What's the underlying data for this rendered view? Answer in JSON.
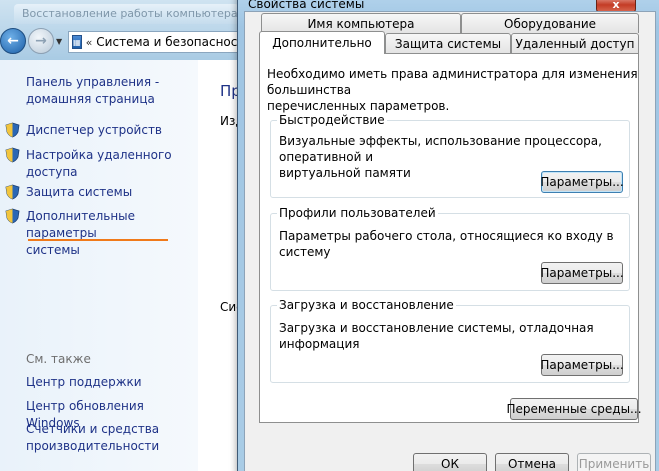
{
  "background": {
    "ghost_tab": "Восстановление работы компьютера",
    "address": {
      "chevron": "«",
      "path": "Система и безопасност"
    },
    "left_pane": {
      "home_link": [
        "Панель управления -",
        "домашняя страница"
      ],
      "links": [
        {
          "lines": [
            "Диспетчер устройств"
          ],
          "icon": "shield-icon"
        },
        {
          "lines": [
            "Настройка удаленного",
            "доступа"
          ],
          "icon": "shield-icon"
        },
        {
          "lines": [
            "Защита системы"
          ],
          "icon": "shield-icon"
        },
        {
          "lines": [
            "Дополнительные параметры",
            "системы"
          ],
          "icon": "shield-icon"
        }
      ],
      "see_also": "См. также",
      "see_also_links": [
        [
          "Центр поддержки"
        ],
        [
          "Центр обновления Windows"
        ],
        [
          "Счетчики и средства",
          "производительности"
        ]
      ]
    },
    "main_fragments": {
      "title": "Пр",
      "frag1": "Изд",
      "frag2": "Сис"
    }
  },
  "dialog": {
    "title": "Свойства системы",
    "close_label": "x",
    "tabs_back": [
      "Имя компьютера",
      "Оборудование"
    ],
    "tabs_front": [
      "Дополнительно",
      "Защита системы",
      "Удаленный доступ"
    ],
    "active_tab": "Дополнительно",
    "admin_note": [
      "Необходимо иметь права администратора для изменения большинства",
      "перечисленных параметров."
    ],
    "groups": [
      {
        "label": "Быстродействие",
        "text": [
          "Визуальные эффекты, использование процессора, оперативной и",
          "виртуальной памяти"
        ],
        "button": "Параметры..."
      },
      {
        "label": "Профили пользователей",
        "text": [
          "Параметры рабочего стола, относящиеся ко входу в систему"
        ],
        "button": "Параметры..."
      },
      {
        "label": "Загрузка и восстановление",
        "text": [
          "Загрузка и восстановление системы, отладочная информация"
        ],
        "button": "Параметры..."
      }
    ],
    "env_button": "Переменные среды...",
    "footer": {
      "ok": "ОК",
      "cancel": "Отмена",
      "apply": "Применить"
    }
  },
  "colors": {
    "link": "#1e3287",
    "accent_underline": "#f07a1a",
    "muted": "#6d6d6d"
  }
}
